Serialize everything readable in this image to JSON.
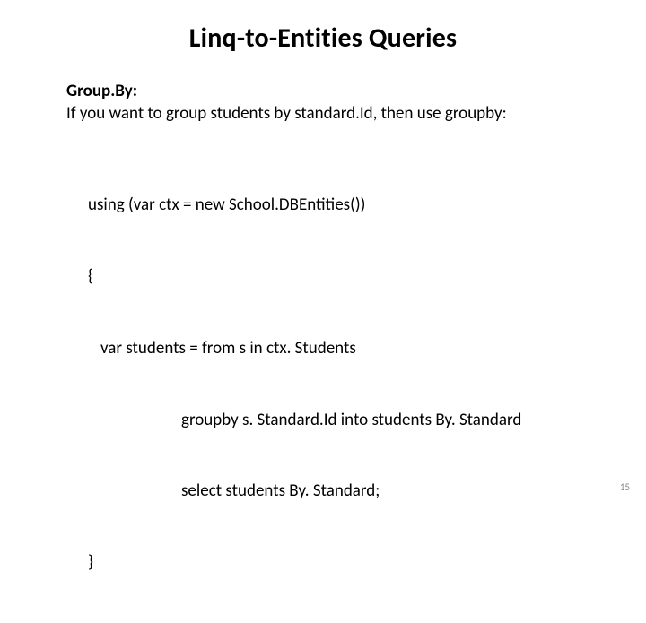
{
  "title": "Linq-to-Entities Queries",
  "heading": "Group.By:",
  "desc": "If you want to group students by standard.Id, then use groupby:",
  "code": {
    "l1": "using (var ctx = new School.DBEntities())",
    "l2": "{",
    "l3": "var students = from s in ctx. Students",
    "l4": "groupby s. Standard.Id into students By. Standard",
    "l5": "select students By. Standard;",
    "l6": "}"
  },
  "page_number": "15"
}
